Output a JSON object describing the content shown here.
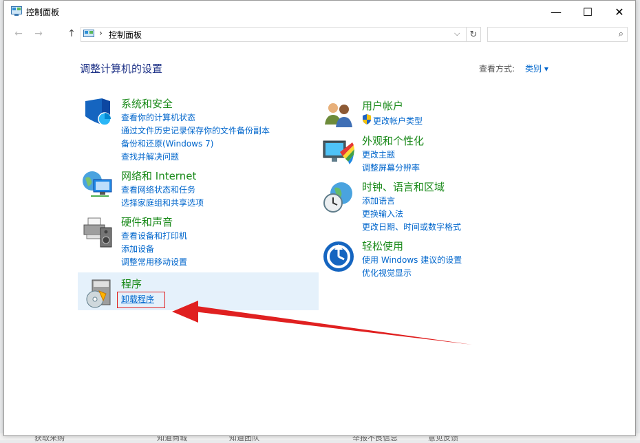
{
  "window": {
    "title": "控制面板",
    "controls": {
      "minimize": "—",
      "maximize": "☐",
      "close": "✕"
    }
  },
  "nav": {
    "back": "←",
    "forward": "→",
    "up": "↑",
    "address_sep": "›",
    "address": "控制面板",
    "dropdown": "⌵",
    "refresh": "↻",
    "search_placeholder": "",
    "search_icon": "⌕"
  },
  "page": {
    "heading": "调整计算机的设置",
    "view_by_label": "查看方式:",
    "view_by_value": "类别 ▾"
  },
  "left_categories": [
    {
      "title": "系统和安全",
      "icon": "shield-icon",
      "links": [
        "查看你的计算机状态",
        "通过文件历史记录保存你的文件备份副本",
        "备份和还原(Windows 7)",
        "查找并解决问题"
      ]
    },
    {
      "title": "网络和 Internet",
      "icon": "network-globe-icon",
      "links": [
        "查看网络状态和任务",
        "选择家庭组和共享选项"
      ]
    },
    {
      "title": "硬件和声音",
      "icon": "printer-speaker-icon",
      "links": [
        "查看设备和打印机",
        "添加设备",
        "调整常用移动设置"
      ]
    },
    {
      "title": "程序",
      "icon": "programs-icon",
      "links": [
        "卸载程序"
      ]
    }
  ],
  "right_categories": [
    {
      "title": "用户帐户",
      "icon": "users-icon",
      "links": [
        "更改帐户类型"
      ]
    },
    {
      "title": "外观和个性化",
      "icon": "monitor-palette-icon",
      "links": [
        "更改主题",
        "调整屏幕分辨率"
      ]
    },
    {
      "title": "时钟、语言和区域",
      "icon": "clock-globe-icon",
      "links": [
        "添加语言",
        "更换输入法",
        "更改日期、时间或数字格式"
      ]
    },
    {
      "title": "轻松使用",
      "icon": "ease-of-access-icon",
      "links": [
        "使用 Windows 建议的设置",
        "优化视觉显示"
      ]
    }
  ],
  "background": {
    "items": [
      "获取采购",
      "知道商城",
      "知道团队",
      "举报不良信息",
      "意见反馈"
    ]
  },
  "colors": {
    "category_title": "#1a8a1a",
    "link": "#0066cc",
    "heading": "#1e3287",
    "highlight": "#e5f1fb",
    "annotation": "#e02020"
  }
}
